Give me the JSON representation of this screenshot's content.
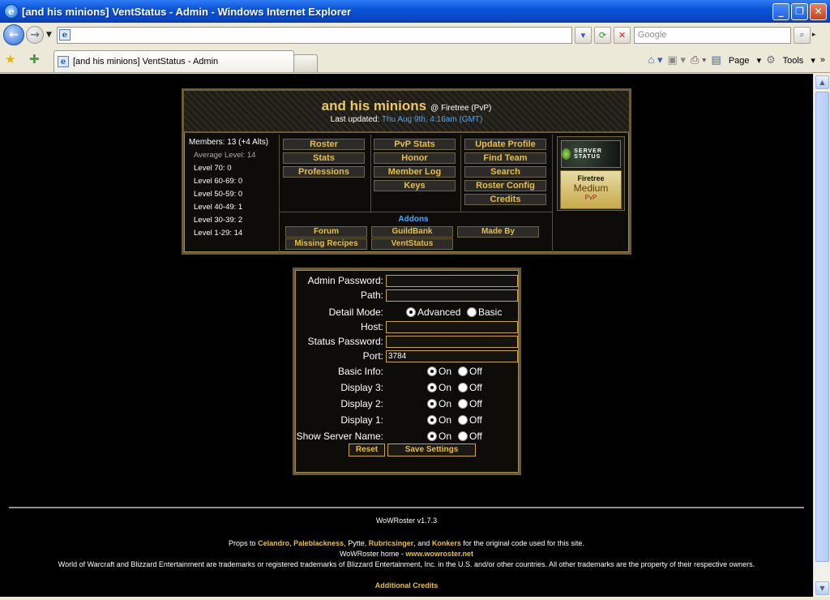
{
  "window": {
    "title": "[and his minions] VentStatus - Admin - Windows Internet Explorer"
  },
  "toolbar": {
    "search_placeholder": "Google",
    "tab_title": "[and his minions] VentStatus - Admin",
    "page_label": "Page",
    "tools_label": "Tools"
  },
  "roster": {
    "guild_name": "and his minions",
    "server": "@ Firetree (PvP)",
    "updated_label": "Last updated:",
    "updated_date": "Thu Aug 9th, 4:16am (GMT)",
    "stats": [
      "Members: 13 (+4 Alts)",
      "Average Level: 14",
      "Level 70: 0",
      "Level 60-69: 0",
      "Level 50-59: 0",
      "Level 40-49: 1",
      "Level 30-39: 2",
      "Level 1-29: 14"
    ],
    "col1": [
      "Roster",
      "Stats",
      "Professions"
    ],
    "col2": [
      "PvP Stats",
      "Honor",
      "Member Log",
      "Keys"
    ],
    "col3": [
      "Update Profile",
      "Find Team",
      "Search",
      "Roster Config",
      "Credits"
    ],
    "addons_label": "Addons",
    "addons": [
      "Forum",
      "GuildBank",
      "Made By",
      "Missing Recipes",
      "VentStatus"
    ],
    "server_status": {
      "logo": "SERVER STATUS",
      "name": "Firetree",
      "load": "Medium",
      "type": "PvP"
    }
  },
  "form": {
    "admin_password_label": "Admin Password:",
    "path_label": "Path:",
    "detail_mode_label": "Detail Mode:",
    "advanced_label": "Advanced",
    "basic_label": "Basic",
    "host_label": "Host:",
    "status_password_label": "Status Password:",
    "port_label": "Port:",
    "port_value": "3784",
    "basic_info_label": "Basic Info:",
    "display3_label": "Display 3:",
    "display2_label": "Display 2:",
    "display1_label": "Display 1:",
    "show_server_label": "Show Server Name:",
    "on_label": "On",
    "off_label": "Off",
    "reset_label": "Reset",
    "save_label": "Save Settings"
  },
  "footer": {
    "version": "WoWRoster v1.7.3",
    "props_prefix": "Props to",
    "props_names": [
      "Celandro",
      "Paleblackness",
      "Pytte",
      "Rubricsinger",
      "Konkers"
    ],
    "props_sep1": ",",
    "props_and": ", and",
    "props_suffix": "for the original code used for this site.",
    "home_prefix": "WoWRoster home -",
    "home_link": "www.wowroster.net",
    "trademark": "World of Warcraft and Blizzard Entertainment are trademarks or registered trademarks of Blizzard Entertainment, Inc. in the U.S. and/or other countries. All other trademarks are the property of their respective owners.",
    "credits_link": "Additional Credits"
  }
}
